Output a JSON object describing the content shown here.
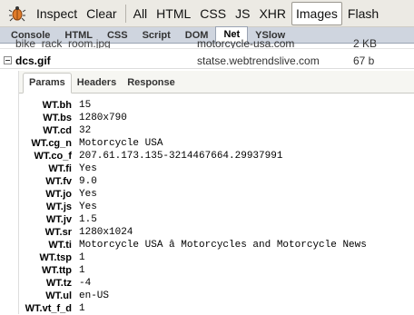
{
  "toolbar": {
    "buttons": [
      "Inspect",
      "Clear",
      "All",
      "HTML",
      "CSS",
      "JS",
      "XHR",
      "Images",
      "Flash"
    ],
    "active": "Images"
  },
  "panel_tabs": [
    "Console",
    "HTML",
    "CSS",
    "Script",
    "DOM",
    "Net",
    "YSlow"
  ],
  "active_panel": "Net",
  "requests": [
    {
      "name": "bike_rack_room.jpg",
      "domain": "motorcycle-usa.com",
      "size": "2 KB"
    },
    {
      "name": "dcs.gif",
      "domain": "statse.webtrendslive.com",
      "size": "67 b"
    }
  ],
  "detail_tabs": [
    "Params",
    "Headers",
    "Response"
  ],
  "active_detail_tab": "Params",
  "params": [
    {
      "name": "WT.bh",
      "value": "15"
    },
    {
      "name": "WT.bs",
      "value": "1280x790"
    },
    {
      "name": "WT.cd",
      "value": "32"
    },
    {
      "name": "WT.cg_n",
      "value": "Motorcycle USA"
    },
    {
      "name": "WT.co_f",
      "value": "207.61.173.135-3214467664.29937991"
    },
    {
      "name": "WT.fi",
      "value": "Yes"
    },
    {
      "name": "WT.fv",
      "value": "9.0"
    },
    {
      "name": "WT.jo",
      "value": "Yes"
    },
    {
      "name": "WT.js",
      "value": "Yes"
    },
    {
      "name": "WT.jv",
      "value": "1.5"
    },
    {
      "name": "WT.sr",
      "value": "1280x1024"
    },
    {
      "name": "WT.ti",
      "value": "Motorcycle USA â Motorcycles and Motorcycle News"
    },
    {
      "name": "WT.tsp",
      "value": "1"
    },
    {
      "name": "WT.ttp",
      "value": "1"
    },
    {
      "name": "WT.tz",
      "value": "-4"
    },
    {
      "name": "WT.ul",
      "value": "en-US"
    },
    {
      "name": "WT.vt_f_d",
      "value": "1"
    }
  ]
}
